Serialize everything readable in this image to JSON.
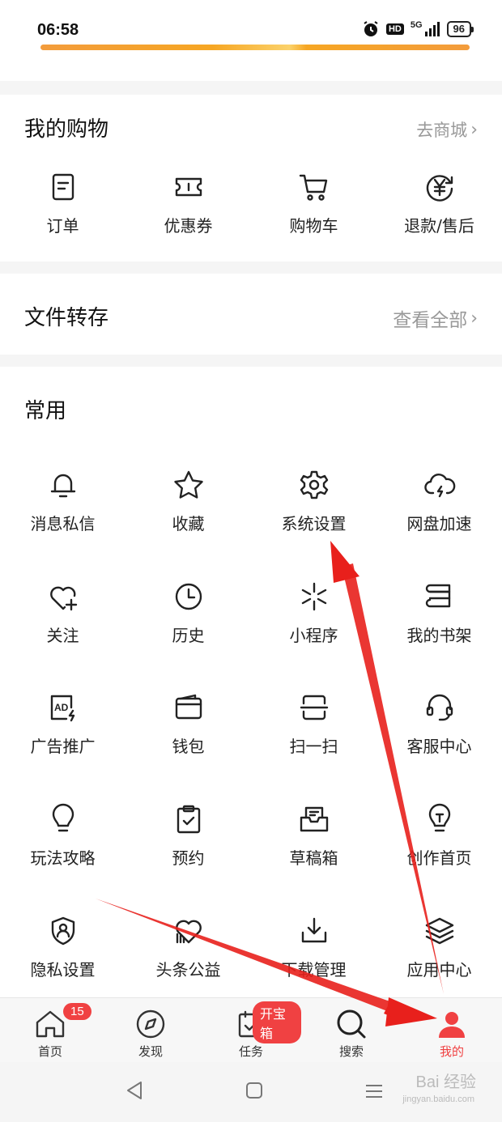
{
  "status": {
    "time": "06:58",
    "hd": "HD",
    "network": "5G",
    "battery": "96"
  },
  "shopping": {
    "title": "我的购物",
    "link": "去商城",
    "items": [
      {
        "label": "订单",
        "icon": "order-icon"
      },
      {
        "label": "优惠券",
        "icon": "coupon-icon"
      },
      {
        "label": "购物车",
        "icon": "cart-icon"
      },
      {
        "label": "退款/售后",
        "icon": "refund-icon"
      }
    ]
  },
  "files": {
    "title": "文件转存",
    "link": "查看全部"
  },
  "common": {
    "title": "常用",
    "items": [
      {
        "label": "消息私信",
        "icon": "bell-icon"
      },
      {
        "label": "收藏",
        "icon": "star-icon"
      },
      {
        "label": "系统设置",
        "icon": "gear-icon"
      },
      {
        "label": "网盘加速",
        "icon": "cloud-lightning-icon"
      },
      {
        "label": "关注",
        "icon": "heart-plus-icon"
      },
      {
        "label": "历史",
        "icon": "clock-icon"
      },
      {
        "label": "小程序",
        "icon": "mini-program-icon"
      },
      {
        "label": "我的书架",
        "icon": "bookshelf-icon"
      },
      {
        "label": "广告推广",
        "icon": "ad-icon"
      },
      {
        "label": "钱包",
        "icon": "wallet-icon"
      },
      {
        "label": "扫一扫",
        "icon": "scan-icon"
      },
      {
        "label": "客服中心",
        "icon": "headset-icon"
      },
      {
        "label": "玩法攻略",
        "icon": "bulb-icon"
      },
      {
        "label": "预约",
        "icon": "clipboard-check-icon"
      },
      {
        "label": "草稿箱",
        "icon": "drafts-icon"
      },
      {
        "label": "创作首页",
        "icon": "creator-bulb-icon"
      },
      {
        "label": "隐私设置",
        "icon": "shield-user-icon"
      },
      {
        "label": "头条公益",
        "icon": "charity-heart-icon"
      },
      {
        "label": "下载管理",
        "icon": "download-icon"
      },
      {
        "label": "应用中心",
        "icon": "layers-icon"
      }
    ]
  },
  "tabbar": {
    "tabs": [
      {
        "label": "首页",
        "icon": "home-icon",
        "badge": "15"
      },
      {
        "label": "发现",
        "icon": "compass-icon"
      },
      {
        "label": "任务",
        "icon": "task-icon",
        "badge": "开宝箱"
      },
      {
        "label": "搜索",
        "icon": "search-icon"
      },
      {
        "label": "我的",
        "icon": "profile-icon",
        "active": true
      }
    ]
  },
  "watermark": {
    "brand": "Bai 经验",
    "url": "jingyan.baidu.com"
  },
  "colors": {
    "accent": "#f04142",
    "arrow": "#e8201c"
  }
}
